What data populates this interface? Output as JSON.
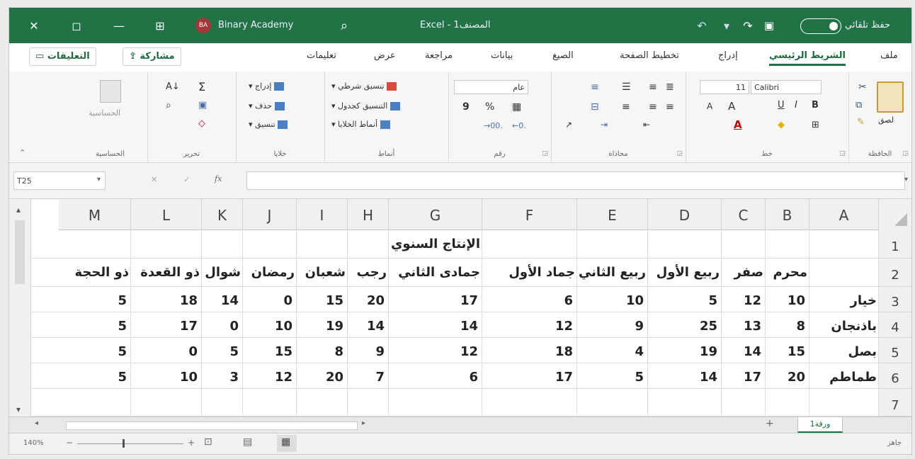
{
  "titlebar": {
    "close": "✕",
    "restore": "◻",
    "minimize": "—",
    "ribbon_display": "⊞",
    "avatar_initials": "BA",
    "user_name": "Binary Academy",
    "search": "⌕",
    "file_title": "Excel - المصنف1",
    "undo": "↶",
    "redo": "↷",
    "save": "💾",
    "autosave_label": "حفظ تلقائي"
  },
  "tabs": [
    "ملف",
    "الشريط الرئيسي",
    "إدراج",
    "تخطيط الصفحة",
    "الصيغ",
    "بيانات",
    "مراجعة",
    "عرض",
    "تعليمات"
  ],
  "share_label": "مشاركة",
  "comments_label": "التعليقات",
  "ribbon": {
    "clipboard": {
      "label": "الحافظة",
      "paste": "لصق"
    },
    "font": {
      "label": "خط",
      "name": "Calibri",
      "size": "11",
      "bold": "B",
      "italic": "I",
      "underline": "U",
      "grow": "A",
      "shrink": "A"
    },
    "alignment": {
      "label": "محاذاة"
    },
    "number": {
      "label": "رقم",
      "format": "عام",
      "percent": "%",
      "comma": "9"
    },
    "styles": {
      "label": "أنماط",
      "conditional": "تنسيق شرطي",
      "as_table": "التنسيق كجدول",
      "cell_styles": "أنماط الخلايا"
    },
    "cells": {
      "label": "خلايا",
      "insert": "إدراج",
      "delete": "حذف",
      "format": "تنسيق"
    },
    "editing": {
      "label": "تحرير",
      "sum": "Σ"
    },
    "sensitivity": {
      "label": "الحساسية",
      "button": "الحساسية"
    }
  },
  "formula_bar": {
    "name_box": "T25",
    "fx": "fx",
    "cancel": "✕",
    "enter": "✓",
    "value": ""
  },
  "columns": [
    "M",
    "L",
    "K",
    "J",
    "I",
    "H",
    "G",
    "F",
    "E",
    "D",
    "C",
    "B",
    "A"
  ],
  "rows": [
    "1",
    "2",
    "3",
    "4",
    "5",
    "6",
    "7"
  ],
  "table": {
    "title": "الإنتاج السنوي",
    "months": [
      "محرم",
      "صفر",
      "ربيع الأول",
      "ربيع الثاني",
      "جماد الأول",
      "جمادى الثاني",
      "رجب",
      "شعبان",
      "رمضان",
      "شوال",
      "ذو القعدة",
      "ذو الحجة"
    ],
    "products": [
      {
        "name": "خيار",
        "values": [
          "10",
          "12",
          "5",
          "10",
          "6",
          "17",
          "20",
          "15",
          "0",
          "14",
          "18",
          "5"
        ]
      },
      {
        "name": "باذنجان",
        "values": [
          "8",
          "13",
          "25",
          "9",
          "12",
          "14",
          "14",
          "19",
          "10",
          "0",
          "17",
          "5"
        ]
      },
      {
        "name": "بصل",
        "values": [
          "15",
          "14",
          "19",
          "4",
          "18",
          "12",
          "9",
          "8",
          "15",
          "5",
          "0",
          "5"
        ]
      },
      {
        "name": "طماطم",
        "values": [
          "20",
          "17",
          "14",
          "5",
          "17",
          "6",
          "7",
          "20",
          "12",
          "3",
          "10",
          "5"
        ]
      }
    ]
  },
  "sheet_tab": "ورقة1",
  "add_sheet": "+",
  "status": {
    "ready": "جاهز",
    "zoom": "140%"
  }
}
